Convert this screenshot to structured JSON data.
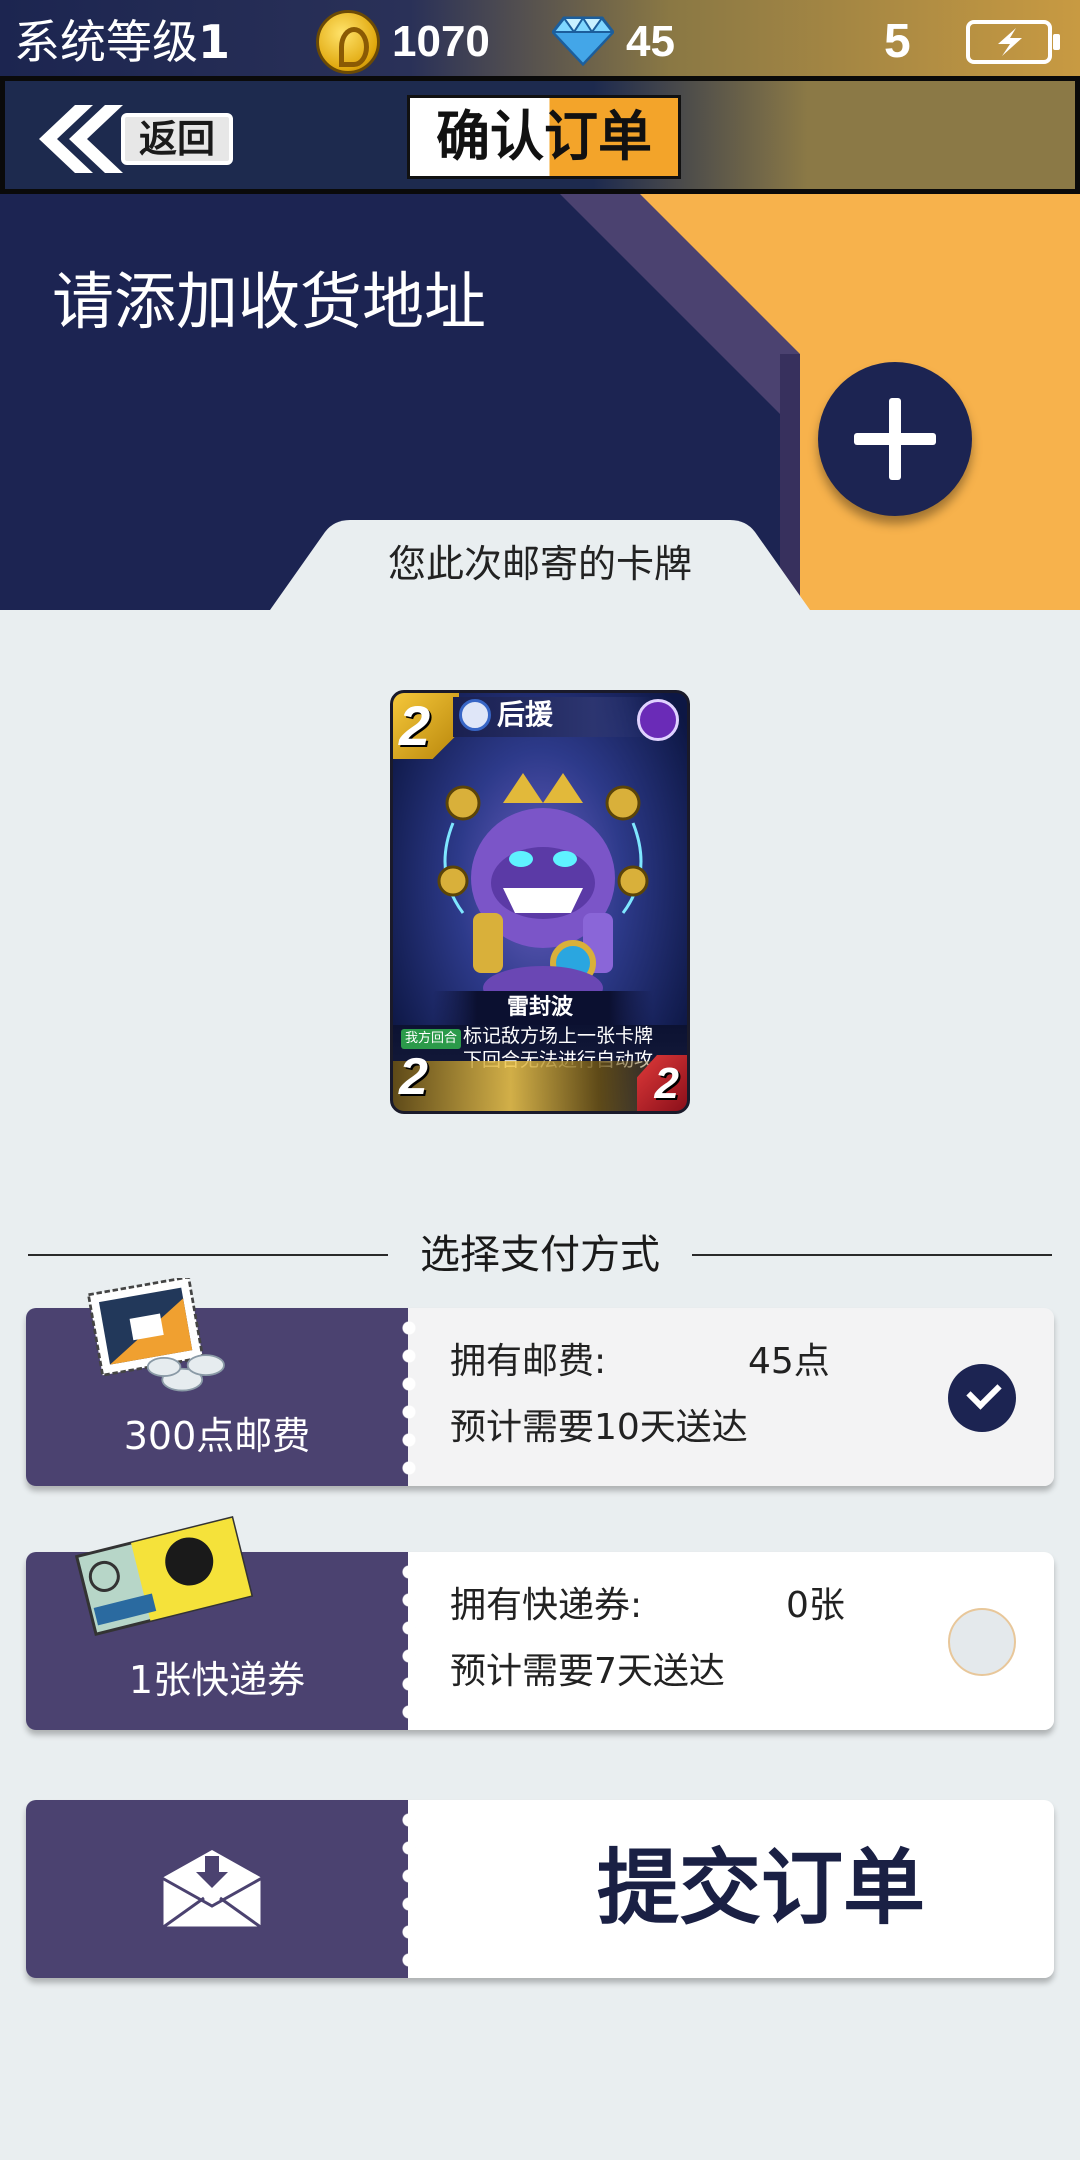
{
  "status_bar": {
    "level_label": "系统等级",
    "level_value": "1",
    "coins": "1070",
    "gems": "45",
    "energy": "5",
    "icons": [
      "coin-icon",
      "diamond-icon",
      "battery-icon"
    ]
  },
  "header": {
    "back_label": "返回",
    "title": "确认订单"
  },
  "address": {
    "prompt": "请添加收货地址",
    "add_icon": "plus-icon"
  },
  "cards_tab": {
    "label": "您此次邮寄的卡牌"
  },
  "card": {
    "cost": "2",
    "type": "后援",
    "name": "雷封波",
    "tag": "我方回合",
    "desc_line1": "标记敌方场上一张卡牌",
    "desc_line2": "下回合无法进行自动攻",
    "attack": "2",
    "health": "2"
  },
  "payment": {
    "title": "选择支付方式",
    "options": [
      {
        "left_label": "300点邮费",
        "owned_label": "拥有邮费:",
        "owned_value": "45点",
        "eta": "预计需要10天送达",
        "selected": true
      },
      {
        "left_label": "1张快递券",
        "owned_label": "拥有快递券:",
        "owned_value": "0张",
        "eta": "预计需要7天送达",
        "selected": false
      }
    ]
  },
  "submit": {
    "label": "提交订单",
    "icon": "envelope-icon"
  },
  "colors": {
    "navy": "#1c2452",
    "purple": "#4b4270",
    "orange": "#f7b24c",
    "background": "#e9eef0"
  }
}
